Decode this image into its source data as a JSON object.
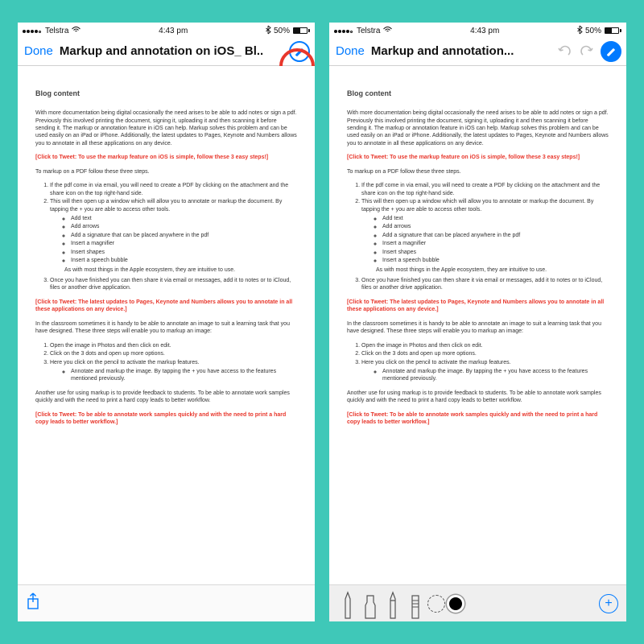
{
  "status": {
    "carrier": "Telstra",
    "time": "4:43 pm",
    "battery_pct": "50%"
  },
  "nav": {
    "done": "Done",
    "title_left": "Markup and annotation on iOS_ Bl..",
    "title_right": "Markup and annotation..."
  },
  "doc": {
    "heading": "Blog content",
    "p1": "With more documentation being digital occasionally the need arises to be able to add notes or sign a pdf. Previously this involved printing the document, signing it, uploading it and then scanning it before sending it. The markup or annotation feature in iOS can help. Markup solves this problem and can be used easily on an iPad or iPhone. Additionally, the latest updates to Pages, Keynote and Numbers allows you to annotate in all these applications on any device.",
    "tweet1": "[Click to Tweet: To use the markup feature on iOS is simple, follow these 3 easy steps!]",
    "p2": "To markup on a PDF follow these three steps.",
    "ol1": {
      "i1": "If the pdf come in via email, you will need to create a PDF by clicking on the attachment and the share icon on the top right-hand side.",
      "i2": "This will then open up a window which will allow you to annotate or markup the document. By tapping the + you are able to access other tools.",
      "i3": "Once you have finished you can then share it via email or messages, add it to notes or to iCloud, files or another drive application."
    },
    "ul1": {
      "a": "Add text",
      "b": "Add arrows",
      "c": "Add a signature that can be placed anywhere in the pdf",
      "d": "Insert a magnifier",
      "e": "Insert shapes",
      "f": "Insert a speech bubble"
    },
    "sub1": "As with most things in the Apple ecosystem, they are intuitive to use.",
    "tweet2": "[Click to Tweet: The latest updates to Pages, Keynote and Numbers allows you to annotate in all these applications on any device.]",
    "p3": "In the classroom sometimes it is handy to be able to annotate an image to suit a learning task that you have designed. These three steps will enable you to markup an image:",
    "ol2": {
      "i1": "Open the image in Photos and then click on edit.",
      "i2": "Click on the 3 dots and open up more options.",
      "i3": "Here you click on the pencil to activate the markup features."
    },
    "ul2": {
      "a": "Annotate and markup the image. By tapping the + you have access to the features mentioned previously."
    },
    "p4": "Another use for using markup is to provide feedback to students. To be able to annotate work samples quickly and with the need to print a hard copy leads to better workflow.",
    "tweet3": "[Click to Tweet: To be able to annotate work samples quickly and with the need to print a hard copy leads to better workflow.]"
  },
  "tools": {
    "plus": "+"
  }
}
